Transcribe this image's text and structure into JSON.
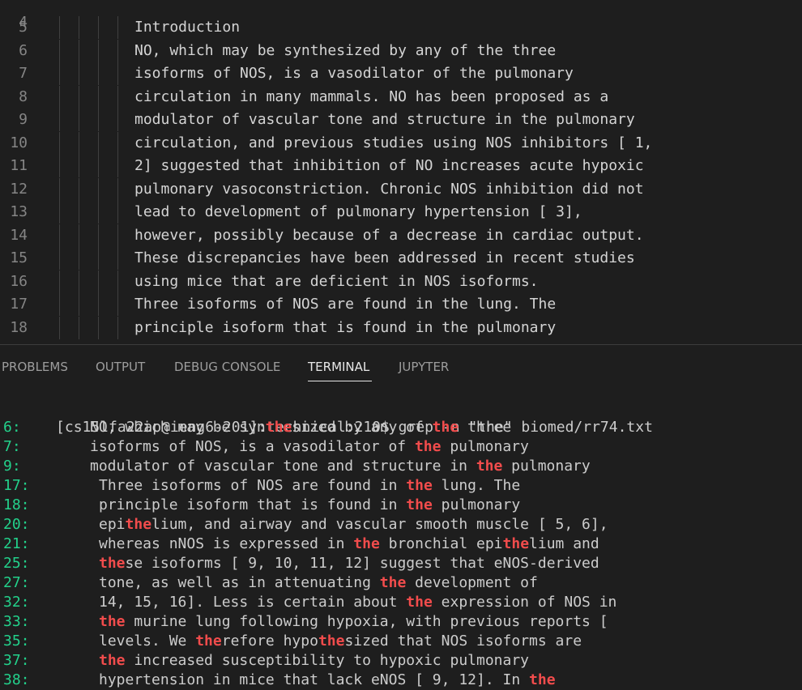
{
  "editor": {
    "top_partial_line_number": "4",
    "lines": [
      {
        "num": "5",
        "text": "Introduction"
      },
      {
        "num": "6",
        "text": "NO, which may be synthesized by any of the three"
      },
      {
        "num": "7",
        "text": "isoforms of NOS, is a vasodilator of the pulmonary"
      },
      {
        "num": "8",
        "text": "circulation in many mammals. NO has been proposed as a"
      },
      {
        "num": "9",
        "text": "modulator of vascular tone and structure in the pulmonary"
      },
      {
        "num": "10",
        "text": "circulation, and previous studies using NOS inhibitors [ 1,"
      },
      {
        "num": "11",
        "text": "2] suggested that inhibition of NO increases acute hypoxic"
      },
      {
        "num": "12",
        "text": "pulmonary vasoconstriction. Chronic NOS inhibition did not"
      },
      {
        "num": "13",
        "text": "lead to development of pulmonary hypertension [ 3],"
      },
      {
        "num": "14",
        "text": "however, possibly because of a decrease in cardiac output."
      },
      {
        "num": "15",
        "text": "These discrepancies have been addressed in recent studies"
      },
      {
        "num": "16",
        "text": "using mice that are deficient in NOS isoforms."
      },
      {
        "num": "17",
        "text": "Three isoforms of NOS are found in the lung. The"
      },
      {
        "num": "18",
        "text": "principle isoform that is found in the pulmonary"
      }
    ]
  },
  "panel": {
    "tabs": [
      {
        "label": "PROBLEMS",
        "active": false
      },
      {
        "label": "OUTPUT",
        "active": false
      },
      {
        "label": "DEBUG CONSOLE",
        "active": false
      },
      {
        "label": "TERMINAL",
        "active": true
      },
      {
        "label": "JUPYTER",
        "active": false
      }
    ]
  },
  "terminal": {
    "prompt": "[cs15lfa22ap@ieng6-201]:technical:210$ grep -n \"the\" biomed/rr74.txt",
    "match_term": "the",
    "match_color": "#f14c4c",
    "linenum_color": "#23d18b",
    "results": [
      {
        "num": "6:",
        "indent": 1,
        "text": "NO, which may be synthesized by any of the three"
      },
      {
        "num": "7:",
        "indent": 1,
        "text": "isoforms of NOS, is a vasodilator of the pulmonary"
      },
      {
        "num": "9:",
        "indent": 1,
        "text": "modulator of vascular tone and structure in the pulmonary"
      },
      {
        "num": "17:",
        "indent": 2,
        "text": "Three isoforms of NOS are found in the lung. The"
      },
      {
        "num": "18:",
        "indent": 2,
        "text": "principle isoform that is found in the pulmonary"
      },
      {
        "num": "20:",
        "indent": 2,
        "text": "epithelium, and airway and vascular smooth muscle [ 5, 6],"
      },
      {
        "num": "21:",
        "indent": 2,
        "text": "whereas nNOS is expressed in the bronchial epithelium and"
      },
      {
        "num": "25:",
        "indent": 2,
        "text": "these isoforms [ 9, 10, 11, 12] suggest that eNOS-derived"
      },
      {
        "num": "27:",
        "indent": 2,
        "text": "tone, as well as in attenuating the development of"
      },
      {
        "num": "32:",
        "indent": 2,
        "text": "14, 15, 16]. Less is certain about the expression of NOS in"
      },
      {
        "num": "33:",
        "indent": 2,
        "text": "the murine lung following hypoxia, with previous reports ["
      },
      {
        "num": "35:",
        "indent": 2,
        "text": "levels. We therefore hypothesized that NOS isoforms are"
      },
      {
        "num": "37:",
        "indent": 2,
        "text": "the increased susceptibility to hypoxic pulmonary"
      },
      {
        "num": "38:",
        "indent": 2,
        "text": "hypertension in mice that lack eNOS [ 9, 12]. In the"
      }
    ]
  }
}
